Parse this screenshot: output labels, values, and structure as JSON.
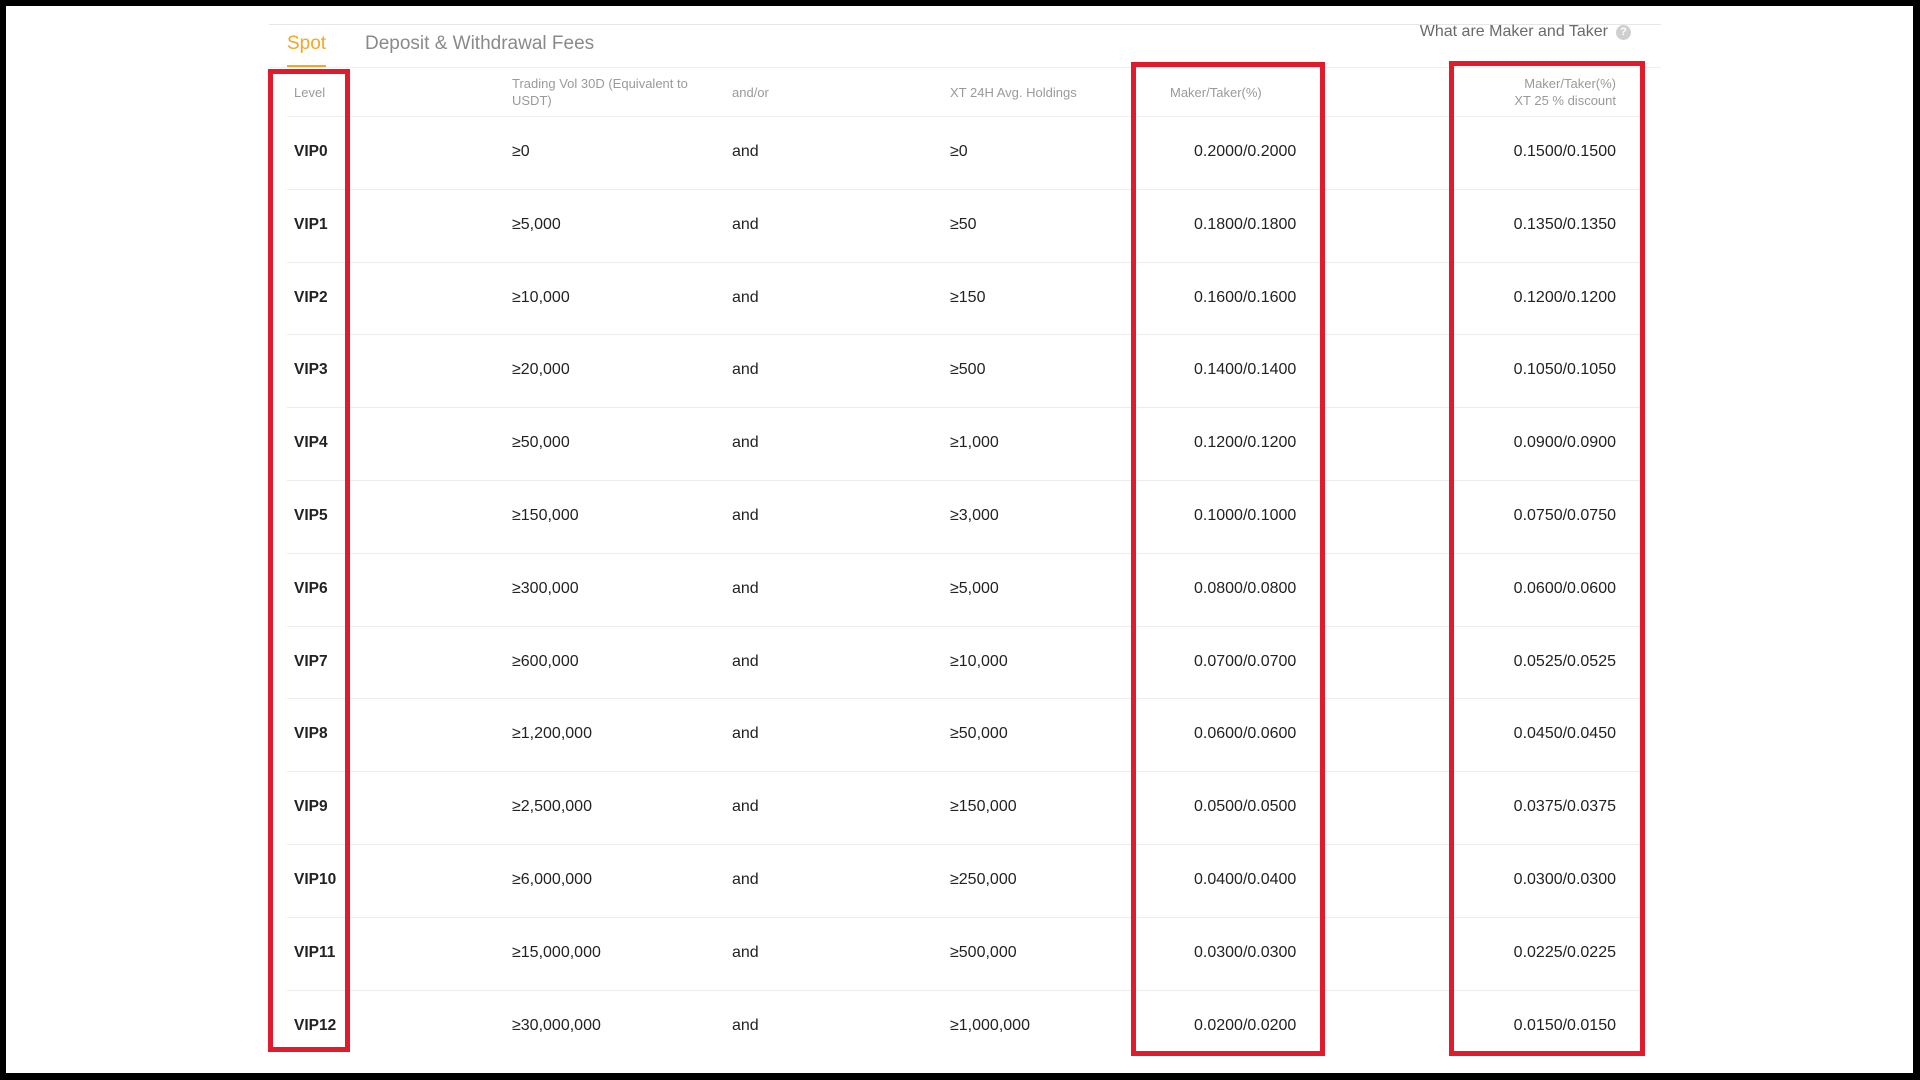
{
  "tabs": [
    {
      "label": "Spot",
      "active": true
    },
    {
      "label": "Deposit & Withdrawal Fees",
      "active": false
    }
  ],
  "help_link": {
    "label": "What are Maker and Taker",
    "icon": "question-circle-icon"
  },
  "columns": {
    "level": "Level",
    "trading_vol": "Trading Vol 30D (Equivalent to USDT)",
    "and_or": "and/or",
    "holdings": "XT 24H Avg. Holdings",
    "maker_taker": "Maker/Taker(%)",
    "discount_line1": "Maker/Taker(%)",
    "discount_line2": "XT 25 % discount"
  },
  "rows": [
    {
      "level": "VIP0",
      "vol": "≥0",
      "cond": "and",
      "hold": "≥0",
      "mt": "0.2000/0.2000",
      "disc": "0.1500/0.1500"
    },
    {
      "level": "VIP1",
      "vol": "≥5,000",
      "cond": "and",
      "hold": "≥50",
      "mt": "0.1800/0.1800",
      "disc": "0.1350/0.1350"
    },
    {
      "level": "VIP2",
      "vol": "≥10,000",
      "cond": "and",
      "hold": "≥150",
      "mt": "0.1600/0.1600",
      "disc": "0.1200/0.1200"
    },
    {
      "level": "VIP3",
      "vol": "≥20,000",
      "cond": "and",
      "hold": "≥500",
      "mt": "0.1400/0.1400",
      "disc": "0.1050/0.1050"
    },
    {
      "level": "VIP4",
      "vol": "≥50,000",
      "cond": "and",
      "hold": "≥1,000",
      "mt": "0.1200/0.1200",
      "disc": "0.0900/0.0900"
    },
    {
      "level": "VIP5",
      "vol": "≥150,000",
      "cond": "and",
      "hold": "≥3,000",
      "mt": "0.1000/0.1000",
      "disc": "0.0750/0.0750"
    },
    {
      "level": "VIP6",
      "vol": "≥300,000",
      "cond": "and",
      "hold": "≥5,000",
      "mt": "0.0800/0.0800",
      "disc": "0.0600/0.0600"
    },
    {
      "level": "VIP7",
      "vol": "≥600,000",
      "cond": "and",
      "hold": "≥10,000",
      "mt": "0.0700/0.0700",
      "disc": "0.0525/0.0525"
    },
    {
      "level": "VIP8",
      "vol": "≥1,200,000",
      "cond": "and",
      "hold": "≥50,000",
      "mt": "0.0600/0.0600",
      "disc": "0.0450/0.0450"
    },
    {
      "level": "VIP9",
      "vol": "≥2,500,000",
      "cond": "and",
      "hold": "≥150,000",
      "mt": "0.0500/0.0500",
      "disc": "0.0375/0.0375"
    },
    {
      "level": "VIP10",
      "vol": "≥6,000,000",
      "cond": "and",
      "hold": "≥250,000",
      "mt": "0.0400/0.0400",
      "disc": "0.0300/0.0300"
    },
    {
      "level": "VIP11",
      "vol": "≥15,000,000",
      "cond": "and",
      "hold": "≥500,000",
      "mt": "0.0300/0.0300",
      "disc": "0.0225/0.0225"
    },
    {
      "level": "VIP12",
      "vol": "≥30,000,000",
      "cond": "and",
      "hold": "≥1,000,000",
      "mt": "0.0200/0.0200",
      "disc": "0.0150/0.0150"
    }
  ],
  "colors": {
    "accent": "#f5a623",
    "highlight_box": "#e01b2b",
    "frame": "#000000"
  }
}
